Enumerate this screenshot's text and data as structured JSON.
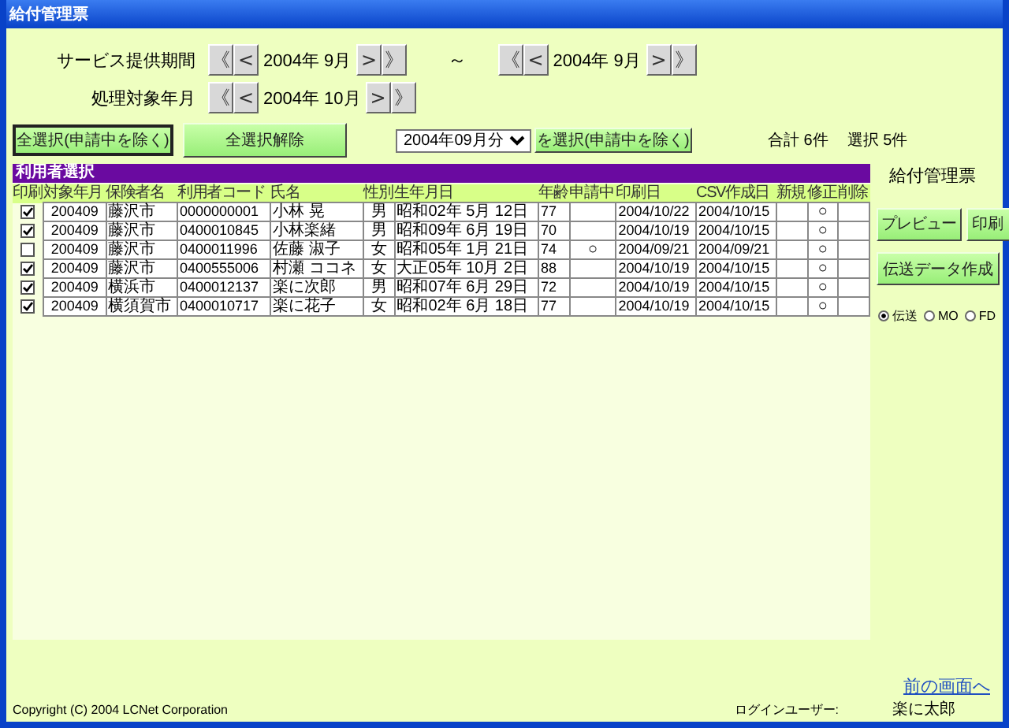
{
  "window": {
    "title": "給付管理票"
  },
  "service_period": {
    "label": "サービス提供期間",
    "start": {
      "first": "《",
      "prev": "<",
      "value": "2004年 9月",
      "next": ">",
      "last": "》"
    },
    "separator": "～",
    "end": {
      "first": "《",
      "prev": "<",
      "value": "2004年 9月",
      "next": ">",
      "last": "》"
    }
  },
  "processing_month": {
    "label": "処理対象年月",
    "picker": {
      "first": "《",
      "prev": "<",
      "value": "2004年 10月",
      "next": ">",
      "last": "》"
    }
  },
  "select_all_button": "全選択(申請中を除く)",
  "clear_button": "全選択解除",
  "month_select": {
    "value": "2004年09月分"
  },
  "select_month_button": "を選択(申請中を除く)",
  "total": "合計 6件",
  "selected_count": "選択 5件",
  "user_table": {
    "title": "利用者選択",
    "columns": [
      "印刷",
      "対象年月",
      "保険者名",
      "利用者コード",
      "氏名",
      "性別",
      "生年月日",
      "年齢",
      "申請中",
      "印刷日",
      "CSV作成日",
      "新規",
      "修正",
      "削除"
    ],
    "rows": [
      {
        "print": true,
        "month": "200409",
        "insurer": "藤沢市",
        "code": "0000000001",
        "name": "小林 晃",
        "sex": "男",
        "birth": "昭和02年 5月 12日",
        "age": "77",
        "print_date": "2004/10/22",
        "csv_date": "2004/10/15",
        "fix": "○"
      },
      {
        "print": true,
        "month": "200409",
        "insurer": "藤沢市",
        "code": "0400010845",
        "name": "小林楽緒",
        "sex": "男",
        "birth": "昭和09年 6月 19日",
        "age": "70",
        "print_date": "2004/10/19",
        "csv_date": "2004/10/15",
        "fix": "○"
      },
      {
        "print": false,
        "month": "200409",
        "insurer": "藤沢市",
        "code": "0400011996",
        "name": "佐藤 淑子",
        "sex": "女",
        "birth": "昭和05年 1月 21日",
        "age": "74",
        "pending": "○",
        "print_date": "2004/09/21",
        "csv_date": "2004/09/21",
        "fix": "○"
      },
      {
        "print": true,
        "month": "200409",
        "insurer": "藤沢市",
        "code": "0400555006",
        "name": "村瀬 ココネ",
        "sex": "女",
        "birth": "大正05年 10月 2日",
        "age": "88",
        "print_date": "2004/10/19",
        "csv_date": "2004/10/15",
        "fix": "○"
      },
      {
        "print": true,
        "month": "200409",
        "insurer": "横浜市",
        "code": "0400012137",
        "name": "楽に次郎",
        "sex": "男",
        "birth": "昭和07年 6月 29日",
        "age": "72",
        "print_date": "2004/10/19",
        "csv_date": "2004/10/15",
        "fix": "○"
      },
      {
        "print": true,
        "month": "200409",
        "insurer": "横須賀市",
        "code": "0400010717",
        "name": "楽に花子",
        "sex": "女",
        "birth": "昭和02年 6月 18日",
        "age": "77",
        "print_date": "2004/10/19",
        "csv_date": "2004/10/15",
        "fix": "○"
      }
    ]
  },
  "side_title": "給付管理票",
  "preview_button": "プレビュー",
  "print_button": "印刷",
  "transmit_button": "伝送データ作成",
  "media": [
    {
      "label": "伝送",
      "selected": true
    },
    {
      "label": "MO",
      "selected": false
    },
    {
      "label": "FD",
      "selected": false
    }
  ],
  "back_link": "前の画面へ",
  "footer": {
    "copyright": "Copyright (C) 2004 LCNet Corporation",
    "login_label": "ログインユーザー:",
    "login_user": "楽に太郎"
  }
}
